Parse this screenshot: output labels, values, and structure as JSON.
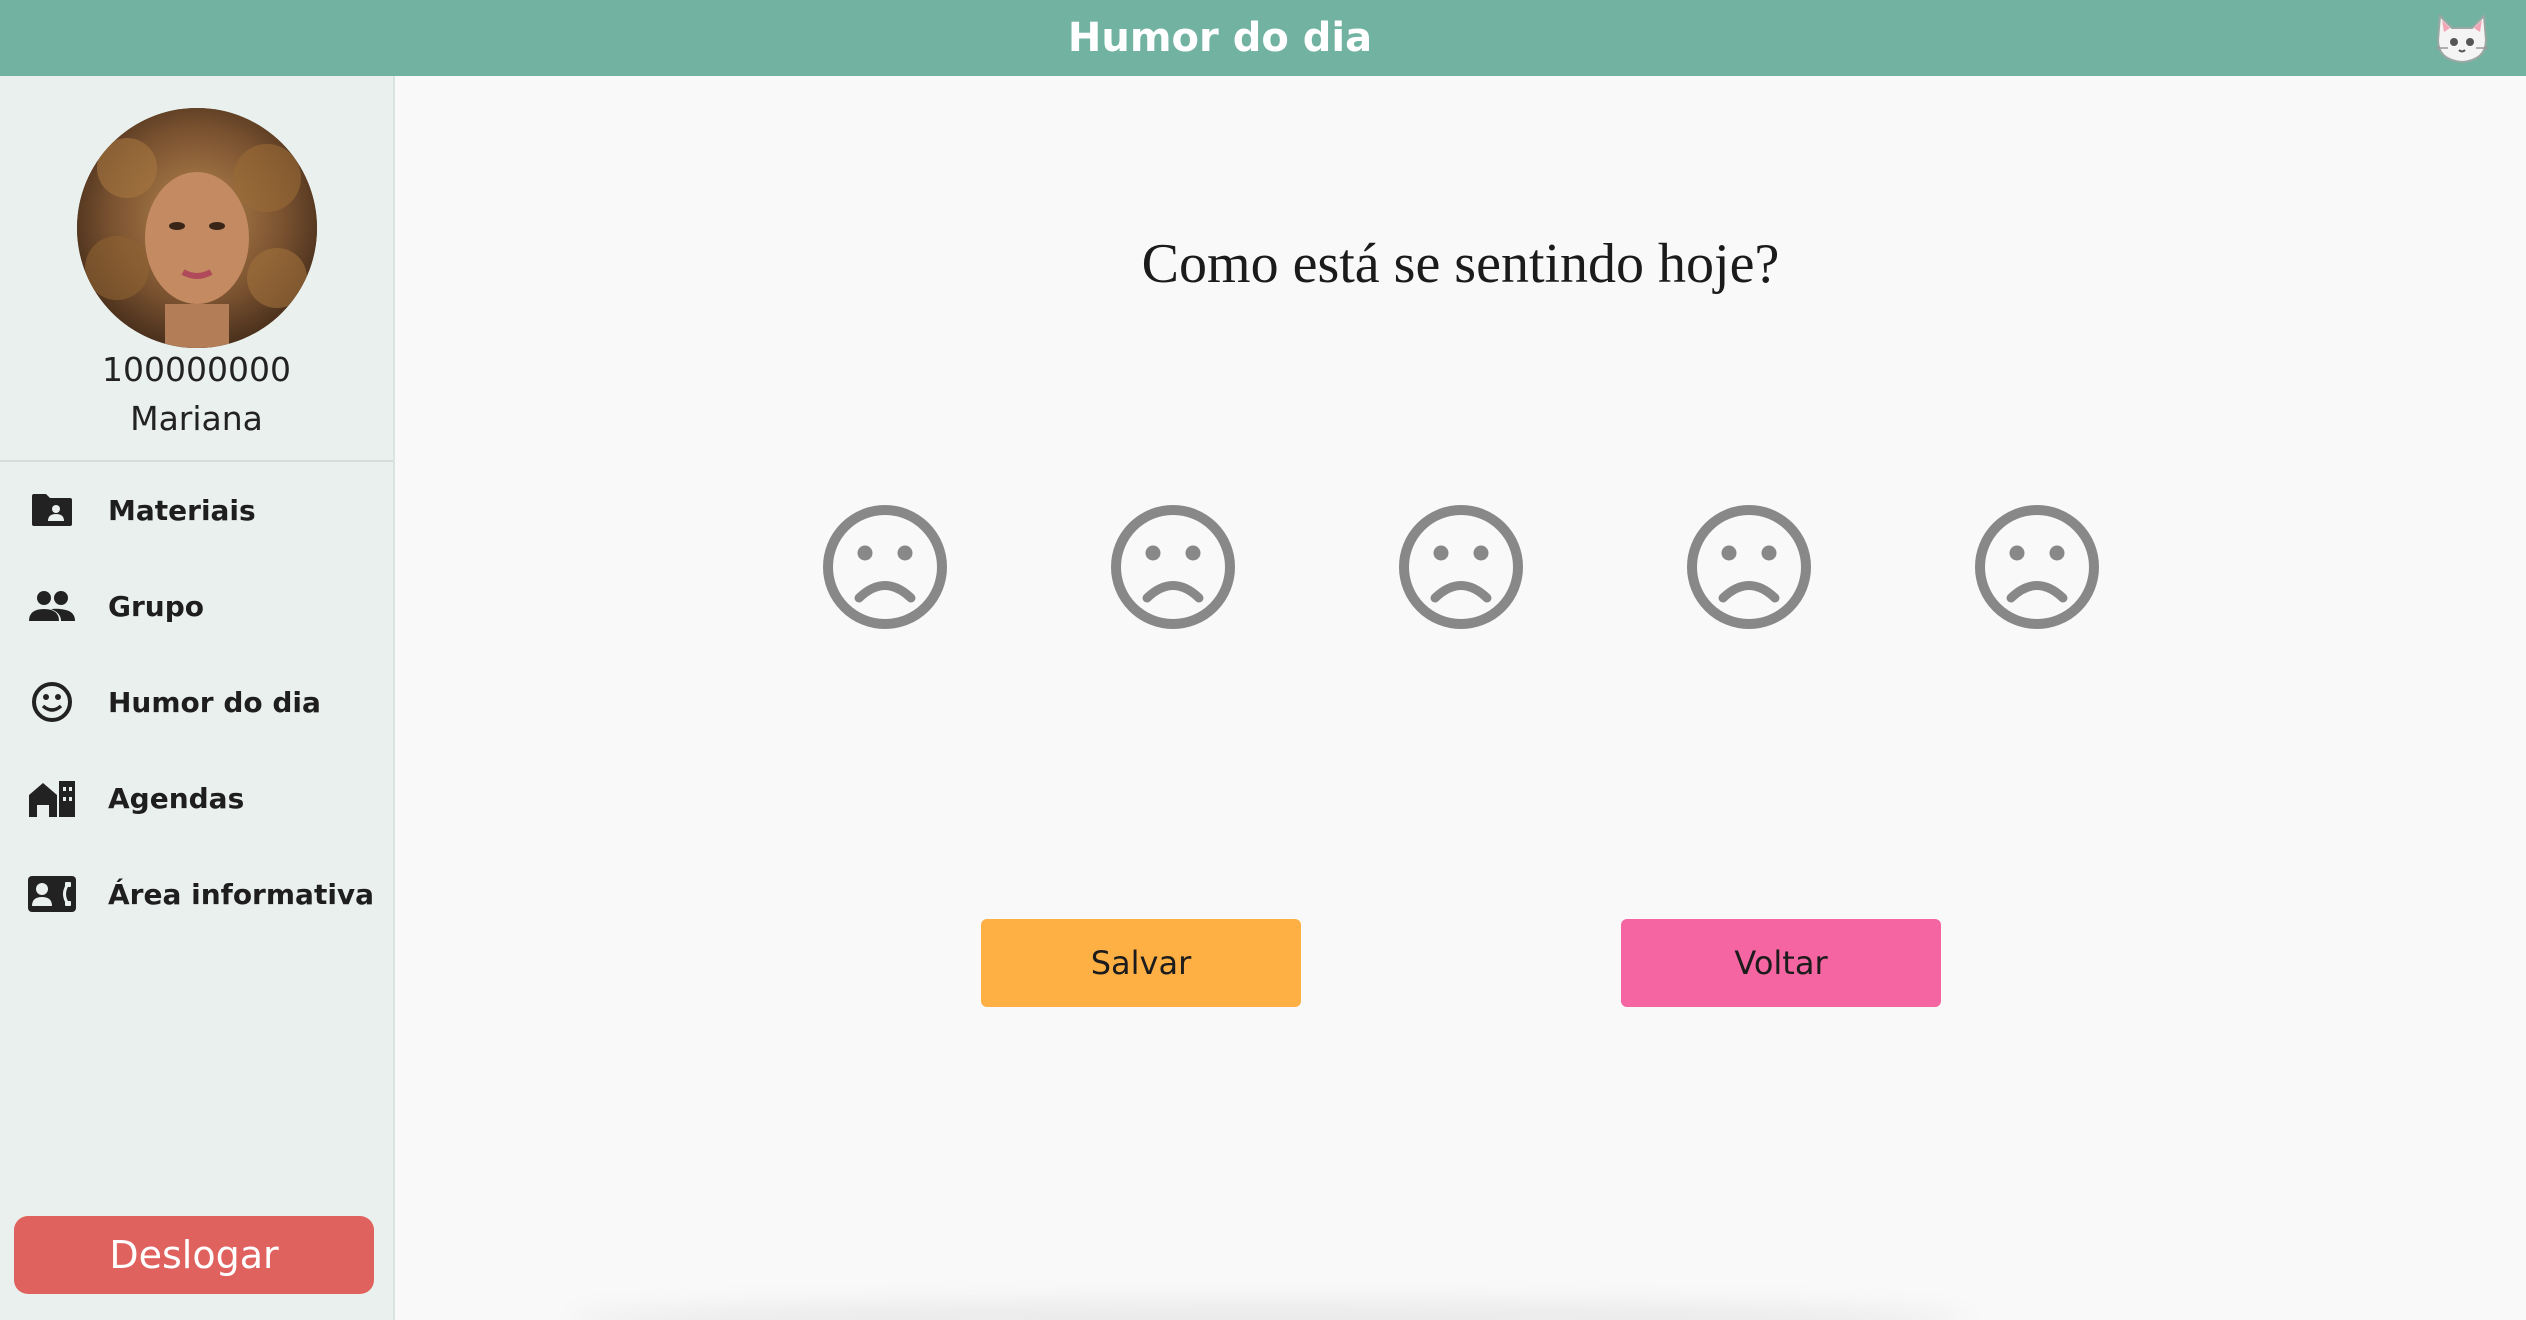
{
  "header": {
    "title": "Humor do dia",
    "mascot_icon": "cat-icon"
  },
  "profile": {
    "id": "100000000",
    "name": "Mariana"
  },
  "sidebar": {
    "items": [
      {
        "label": "Materiais",
        "icon": "folder-account-icon"
      },
      {
        "label": "Grupo",
        "icon": "group-icon"
      },
      {
        "label": "Humor do dia",
        "icon": "smiley-icon"
      },
      {
        "label": "Agendas",
        "icon": "city-icon"
      },
      {
        "label": "Área informativa",
        "icon": "contact-phone-icon"
      }
    ],
    "logout_label": "Deslogar"
  },
  "main": {
    "question": "Como está se sentindo hoje?",
    "mood_options": [
      "sad-face-icon",
      "sad-face-icon",
      "sad-face-icon",
      "sad-face-icon",
      "sad-face-icon"
    ],
    "save_label": "Salvar",
    "back_label": "Voltar"
  },
  "colors": {
    "header": "#72b2a1",
    "sidebar": "#eaf0ed",
    "logout": "#e0625f",
    "save": "#feb044",
    "back": "#f465a1",
    "face": "#888888"
  }
}
